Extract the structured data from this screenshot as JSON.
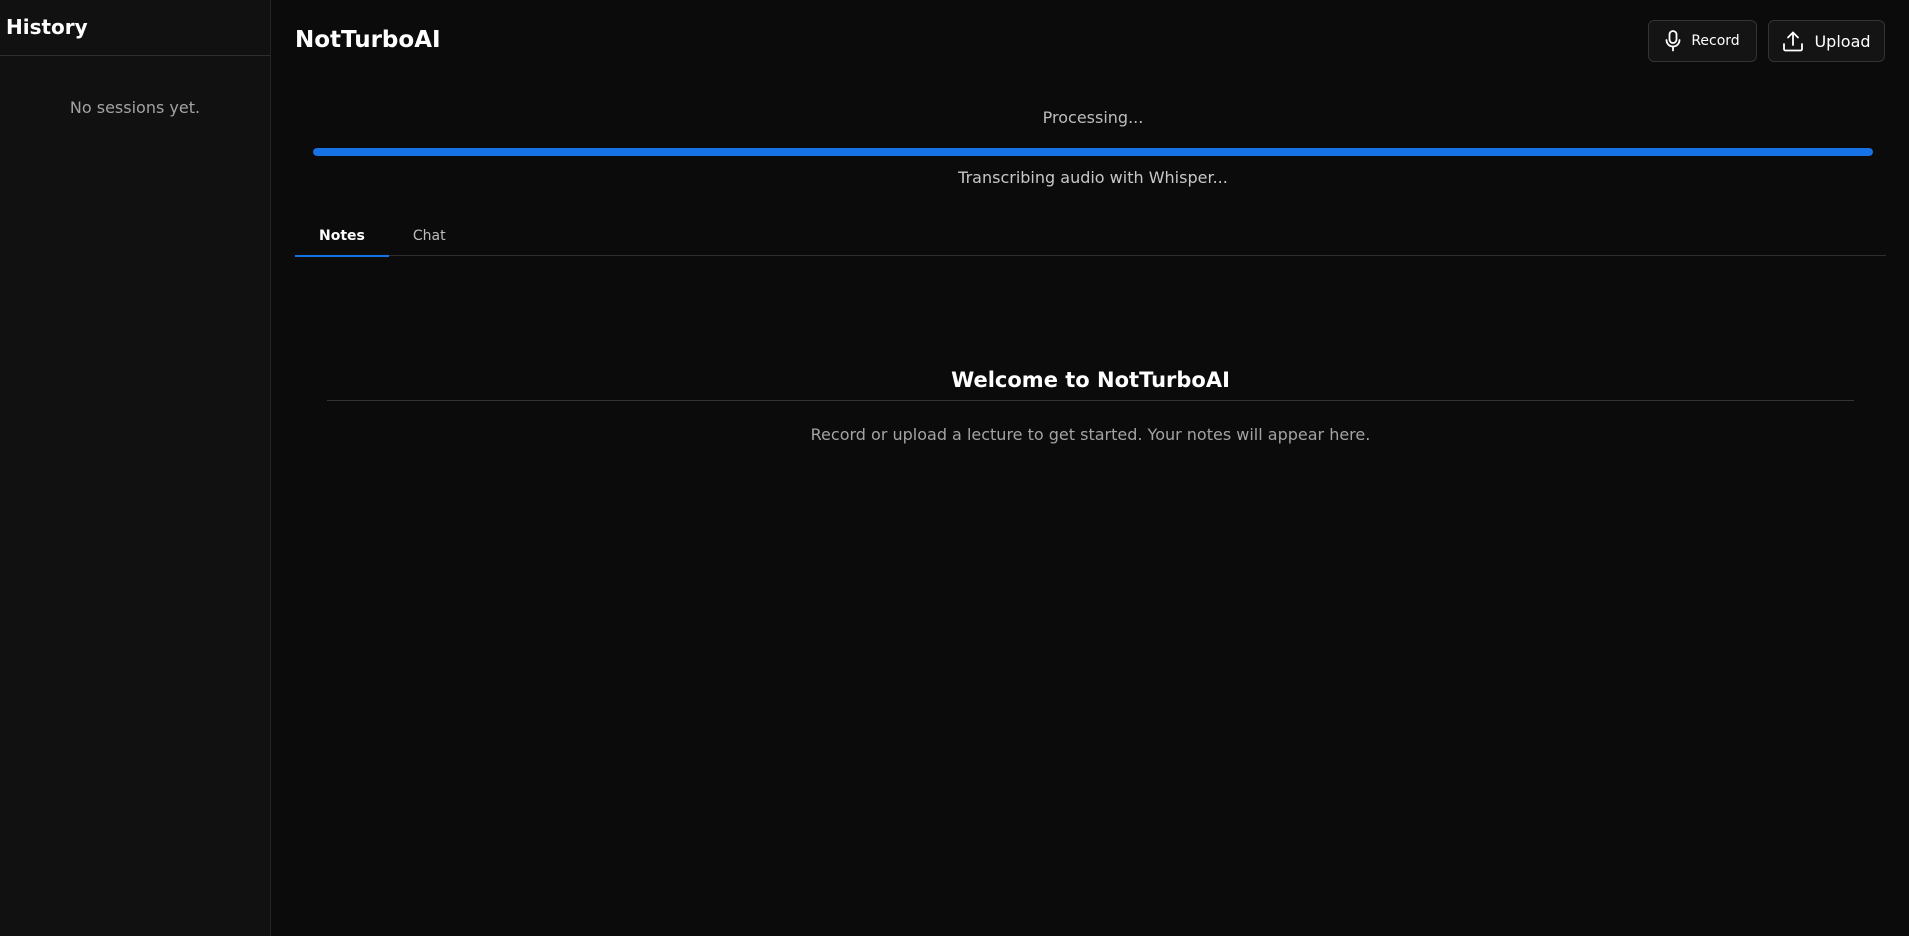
{
  "sidebar": {
    "title": "History",
    "empty_text": "No sessions yet."
  },
  "header": {
    "title": "NotTurboAI",
    "record_label": "Record",
    "upload_label": "Upload"
  },
  "progress": {
    "title": "Processing...",
    "step": "Transcribing audio with Whisper...",
    "percent": 100,
    "color": "#1772e6"
  },
  "tabs": [
    {
      "label": "Notes",
      "active": true
    },
    {
      "label": "Chat",
      "active": false
    }
  ],
  "welcome": {
    "title": "Welcome to NotTurboAI",
    "text": "Record or upload a lecture to get started. Your notes will appear here."
  },
  "icons": {
    "record": "microphone-icon",
    "upload": "upload-icon"
  }
}
